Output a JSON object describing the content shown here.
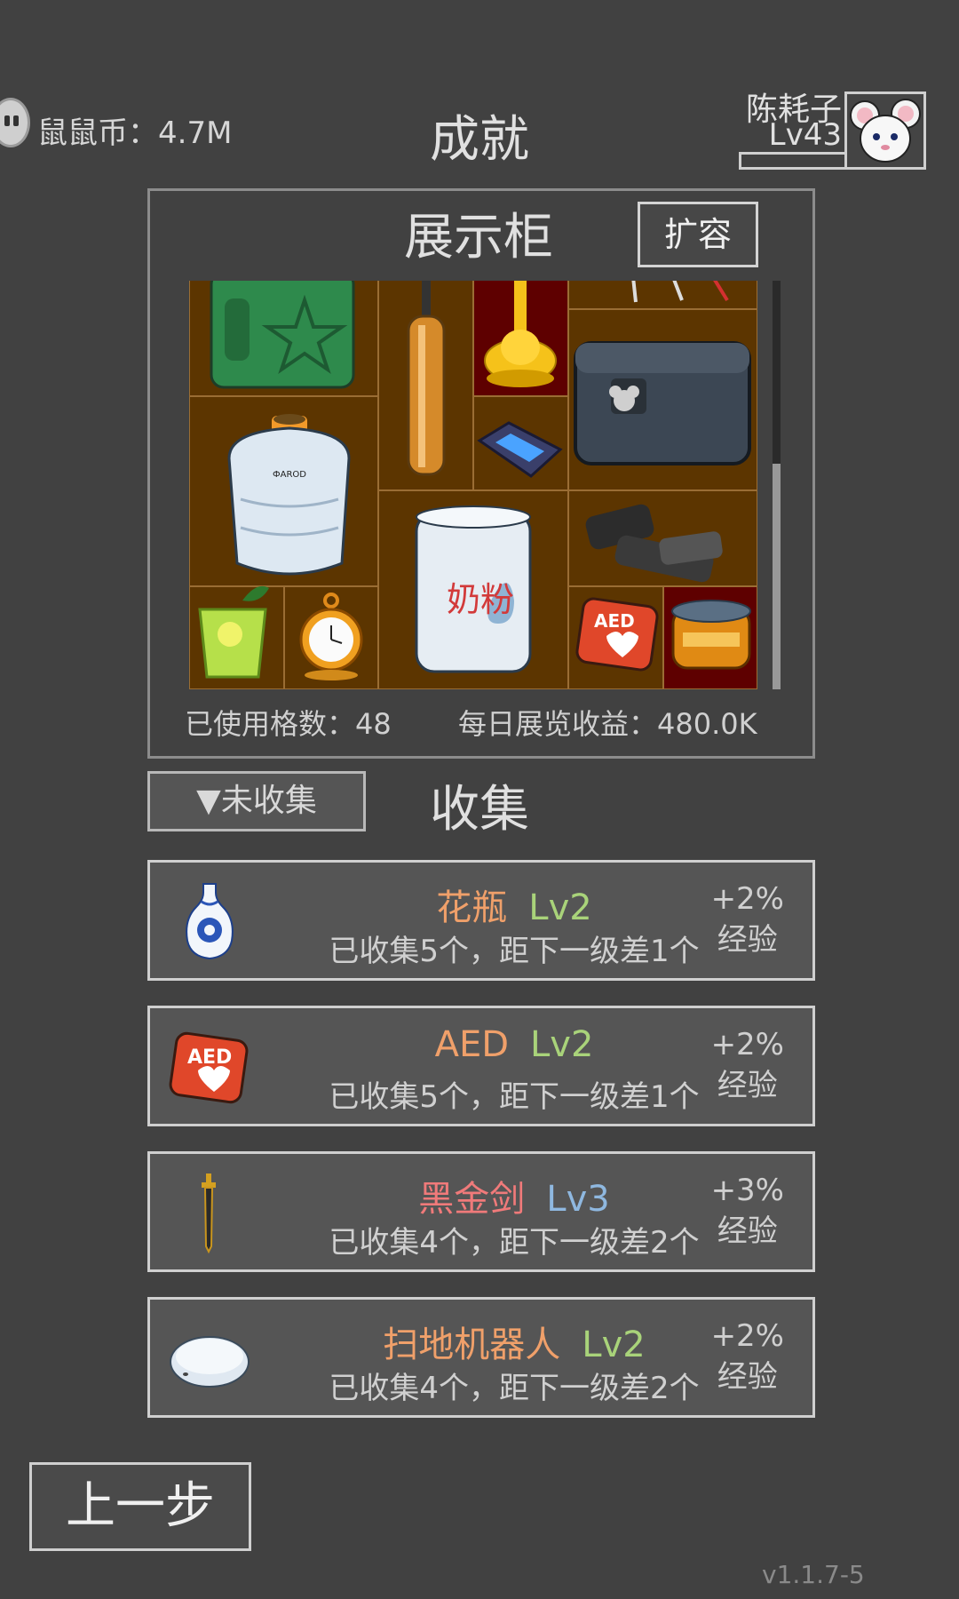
{
  "header": {
    "coin_label": "鼠鼠币：4.7M",
    "title": "成就",
    "player_name": "陈耗子",
    "player_level": "Lv43"
  },
  "showcase": {
    "title": "展示柜",
    "expand_button": "扩容",
    "items": {
      "aed_label": "AED",
      "formula_label": "奶粉",
      "dewar_label": "ФАRОD"
    },
    "used_slots": "已使用格数：48",
    "daily_income": "每日展览收益：480.0K"
  },
  "collection": {
    "filter_button": "▼未收集",
    "title": "收集",
    "cards": [
      {
        "name": "花瓶",
        "level": "Lv2",
        "name_color": "#f0a06a",
        "level_color": "#a9d37a",
        "progress": "已收集5个，距下一级差1个",
        "bonus": "+2%",
        "bonus_label": "经验",
        "icon": "vase-icon"
      },
      {
        "name": "AED",
        "level": "Lv2",
        "name_color": "#f0a06a",
        "level_color": "#a9d37a",
        "progress": "已收集5个，距下一级差1个",
        "bonus": "+2%",
        "bonus_label": "经验",
        "icon": "aed-icon",
        "icon_label": "AED"
      },
      {
        "name": "黑金剑",
        "level": "Lv3",
        "name_color": "#f07a7a",
        "level_color": "#8fb8e0",
        "progress": "已收集4个，距下一级差2个",
        "bonus": "+3%",
        "bonus_label": "经验",
        "icon": "sword-icon"
      },
      {
        "name": "扫地机器人",
        "level": "Lv2",
        "name_color": "#f0a06a",
        "level_color": "#a9d37a",
        "progress": "已收集4个，距下一级差2个",
        "bonus": "+2%",
        "bonus_label": "经验",
        "icon": "robot-vacuum-icon"
      }
    ]
  },
  "footer": {
    "back_button": "上一步",
    "version": "v1.1.7-5"
  }
}
